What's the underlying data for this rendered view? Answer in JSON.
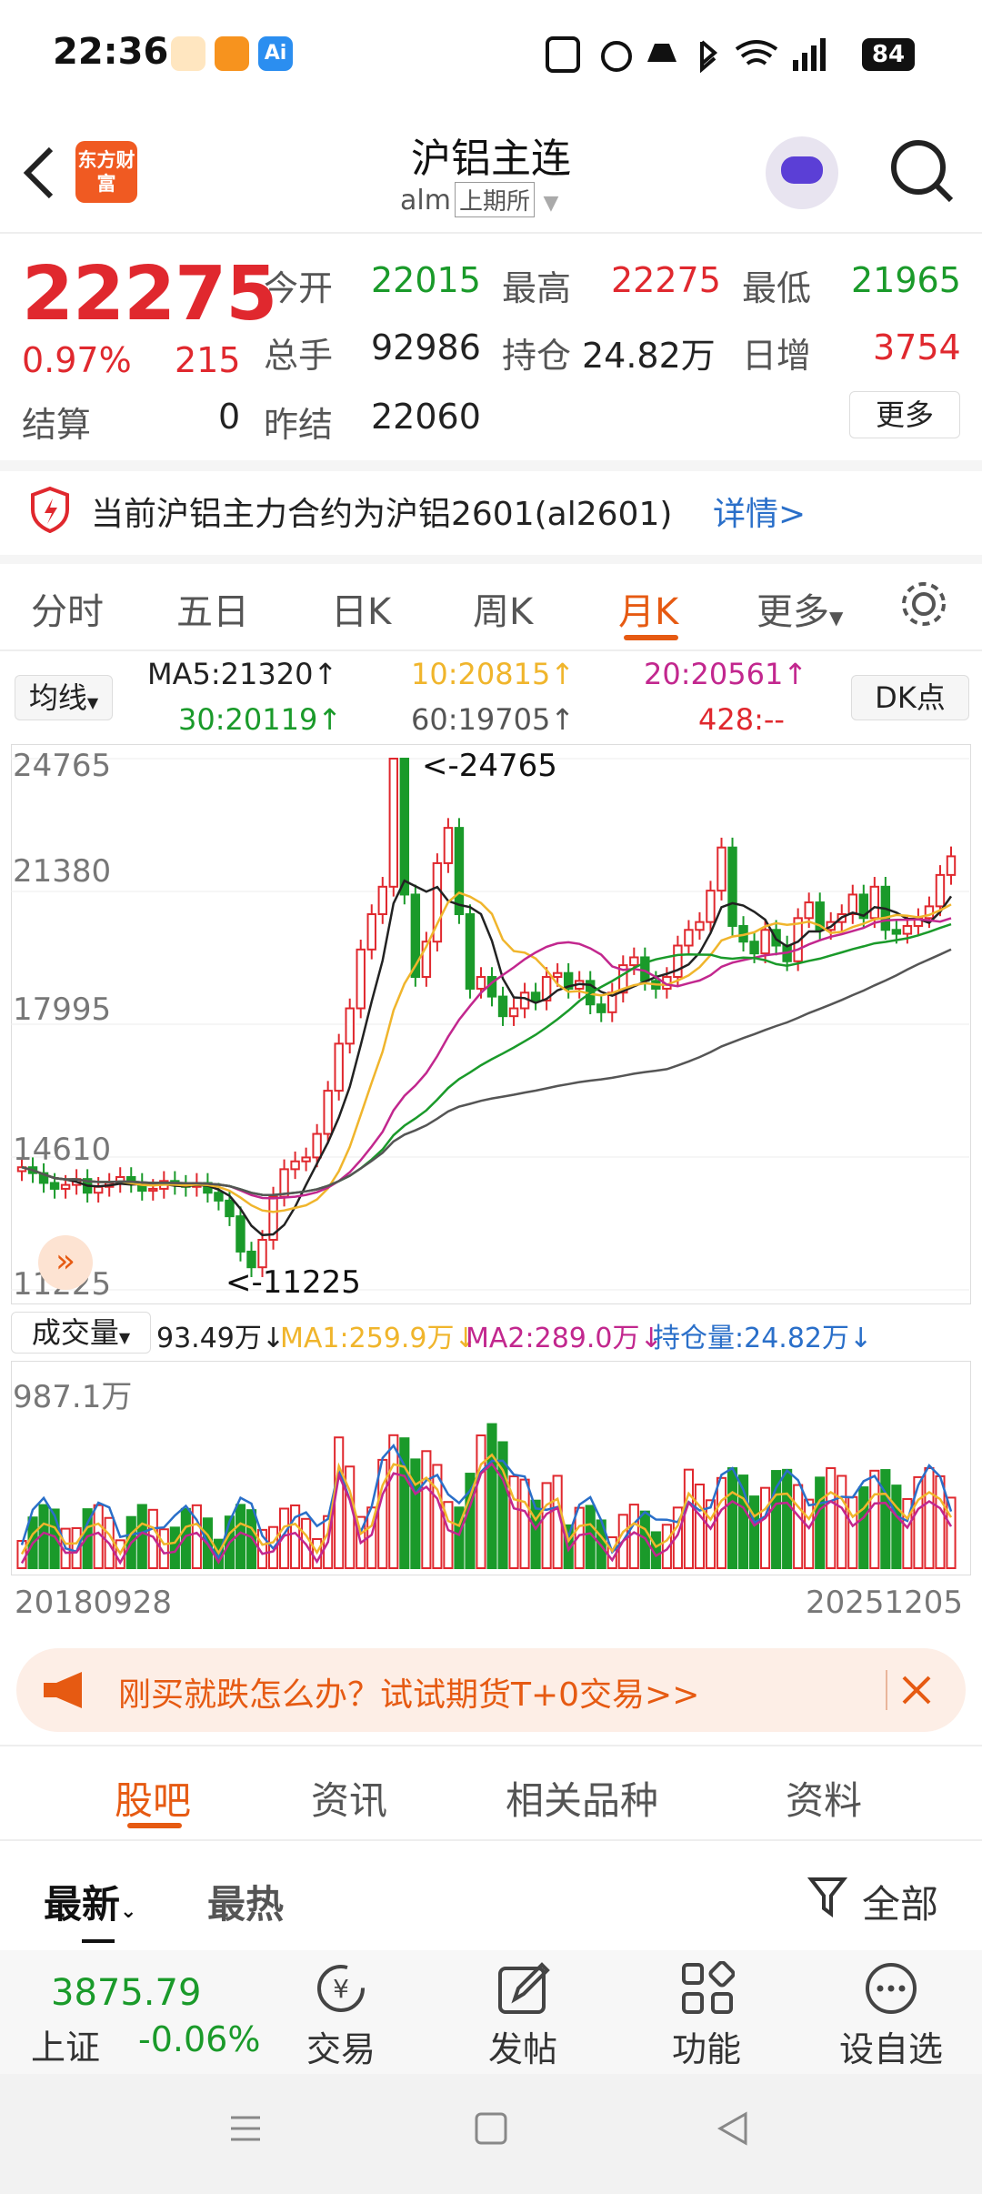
{
  "status_bar": {
    "time": "22:36",
    "battery": "84"
  },
  "header": {
    "back_icon": "back-arrow-icon",
    "logo_text": "东方财富",
    "title": "沪铝主连",
    "code": "alm",
    "exchange": "上期所"
  },
  "quote": {
    "price": "22275",
    "change_pct": "0.97%",
    "change": "215",
    "settle_label": "结算",
    "settle": "0",
    "prev_settle_label": "昨结",
    "prev_settle": "22060",
    "open_label": "今开",
    "open": "22015",
    "high_label": "最高",
    "high": "22275",
    "low_label": "最低",
    "low": "21965",
    "volume_label": "总手",
    "volume": "92986",
    "oi_label": "持仓",
    "oi": "24.82万",
    "oi_change_label": "日增",
    "oi_change": "3754",
    "more_button": "更多"
  },
  "notice": {
    "text": "当前沪铝主力合约为沪铝2601(al2601)",
    "link": "详情>"
  },
  "period_tabs": [
    {
      "label": "分时"
    },
    {
      "label": "五日"
    },
    {
      "label": "日K"
    },
    {
      "label": "周K"
    },
    {
      "label": "月K"
    },
    {
      "label": "更多"
    }
  ],
  "active_tab": "月K",
  "indicator": {
    "ma_select": "均线",
    "ma5": "MA5:21320↑",
    "ma10": "10:20815↑",
    "ma20": "20:20561↑",
    "ma30": "30:20119↑",
    "ma60": "60:19705↑",
    "ma428": "428:--",
    "dk_button": "DK点"
  },
  "chart_axis": {
    "y1": "24765",
    "y2": "21380",
    "y3": "17995",
    "y4": "14610",
    "y5": "11225",
    "max_label": "<-24765",
    "min_label": "<-11225"
  },
  "volume_indicator": {
    "select": "成交量",
    "vol": "93.49万↓",
    "ma1": "MA1:259.9万↓",
    "ma2": "MA2:289.0万↓",
    "oi": "持仓量:24.82万↓",
    "max": "987.1万",
    "date_start": "20180928",
    "date_end": "20251205"
  },
  "ad": {
    "text": "刚买就跌怎么办？试试期货T+0交易>>"
  },
  "section_tabs": [
    {
      "label": "股吧"
    },
    {
      "label": "资讯"
    },
    {
      "label": "相关品种"
    },
    {
      "label": "资料"
    }
  ],
  "sub_tabs": {
    "latest": "最新",
    "hot": "最热",
    "filter": "全部"
  },
  "bottom_bar": {
    "index_value": "3875.79",
    "index_name": "上证",
    "index_change": "-0.06%",
    "trade": "交易",
    "post": "发帖",
    "function": "功能",
    "watchlist": "设自选"
  },
  "chart_data": {
    "type": "candlestick",
    "title": "沪铝主连 月K",
    "x_range": [
      "20180928",
      "20251205"
    ],
    "ylim": [
      11225,
      24765
    ],
    "y_ticks": [
      24765,
      21380,
      17995,
      14610,
      11225
    ],
    "annotations": [
      "<-24765",
      "<-11225"
    ],
    "close_series_approx": [
      14350,
      14200,
      13950,
      13800,
      13900,
      14050,
      13700,
      13850,
      13950,
      14100,
      13950,
      13750,
      13800,
      14000,
      13900,
      13850,
      13950,
      13700,
      13500,
      13100,
      12200,
      11800,
      12500,
      13600,
      14300,
      14500,
      14600,
      15200,
      16300,
      17500,
      18400,
      19900,
      20800,
      21500,
      24765,
      21300,
      19200,
      20100,
      22100,
      23000,
      20800,
      18900,
      19200,
      18700,
      18200,
      18400,
      18800,
      18600,
      19200,
      19300,
      18900,
      19100,
      18500,
      18300,
      18800,
      19500,
      19700,
      19100,
      18900,
      19200,
      20000,
      20400,
      20600,
      21400,
      22500,
      20500,
      20100,
      19800,
      20400,
      20000,
      19600,
      20700,
      21100,
      20400,
      20600,
      20800,
      21300,
      20700,
      21500,
      20400,
      20300,
      20500,
      20700,
      21000,
      21800,
      22275
    ]
  }
}
